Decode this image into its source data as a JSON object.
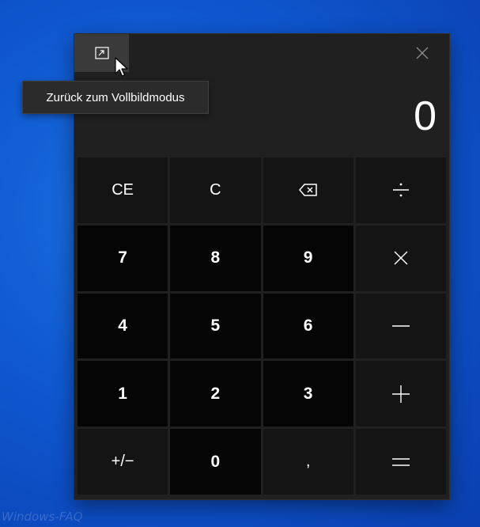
{
  "titlebar": {
    "restore_icon": "restore-fullscreen-icon",
    "close_icon": "close-icon"
  },
  "tooltip": {
    "text": "Zurück zum Vollbildmodus"
  },
  "display": {
    "value": "0"
  },
  "keys": {
    "ce": "CE",
    "c": "C",
    "backspace_icon": "backspace-icon",
    "divide_icon": "divide-icon",
    "n7": "7",
    "n8": "8",
    "n9": "9",
    "multiply_icon": "multiply-icon",
    "n4": "4",
    "n5": "5",
    "n6": "6",
    "minus_icon": "minus-icon",
    "n1": "1",
    "n2": "2",
    "n3": "3",
    "plus_icon": "plus-icon",
    "negate": "+/−",
    "n0": "0",
    "decimal": ",",
    "equals_icon": "equals-icon"
  },
  "watermark": "Windows-FAQ",
  "colors": {
    "background": "#0f57cf",
    "window": "#202020",
    "op_key": "#141414",
    "num_key": "#050505"
  }
}
